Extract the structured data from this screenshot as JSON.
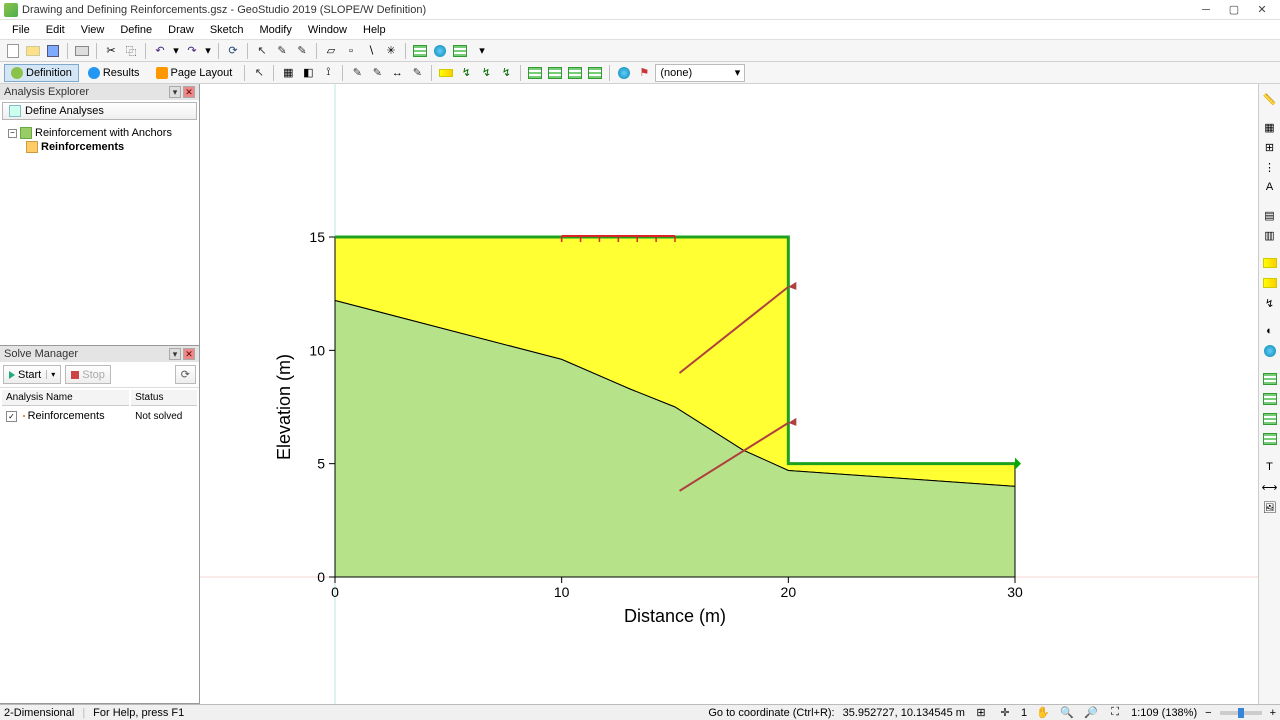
{
  "title_bar": {
    "text": "Drawing and Defining Reinforcements.gsz - GeoStudio 2019 (SLOPE/W Definition)"
  },
  "menus": [
    "File",
    "Edit",
    "View",
    "Define",
    "Draw",
    "Sketch",
    "Modify",
    "Window",
    "Help"
  ],
  "mode_tabs": {
    "definition": "Definition",
    "results": "Results",
    "page_layout": "Page Layout"
  },
  "dropdown_value": "(none)",
  "analysis_explorer": {
    "title": "Analysis Explorer",
    "define_button": "Define Analyses",
    "tree": {
      "root": "Reinforcement with Anchors",
      "child": "Reinforcements"
    }
  },
  "solve_manager": {
    "title": "Solve Manager",
    "start": "Start",
    "stop": "Stop",
    "cols": {
      "name": "Analysis Name",
      "status": "Status"
    },
    "row": {
      "name": "Reinforcements",
      "status": "Not solved"
    }
  },
  "status": {
    "left1": "2-Dimensional",
    "left2": "For Help, press F1",
    "coord_label": "Go to coordinate (Ctrl+R):",
    "coord_value": "35.952727, 10.134545 m",
    "page": "1",
    "zoom_text": "1:109 (138%)"
  },
  "chart_data": {
    "type": "area",
    "title": "",
    "xlabel": "Distance (m)",
    "ylabel": "Elevation (m)",
    "xlim": [
      0,
      30
    ],
    "ylim": [
      0,
      15
    ],
    "xticks": [
      0,
      10,
      20,
      30
    ],
    "yticks": [
      0,
      5,
      10,
      15
    ],
    "regions": [
      {
        "name": "upper-fill",
        "color": "#ffff33",
        "polygon": [
          [
            0,
            15
          ],
          [
            20,
            15
          ],
          [
            20,
            5
          ],
          [
            30,
            5
          ],
          [
            30,
            4
          ],
          [
            20,
            4.7
          ],
          [
            18,
            5.6
          ],
          [
            15,
            7.5
          ],
          [
            13,
            8.3
          ],
          [
            10,
            9.6
          ],
          [
            0,
            12.2
          ]
        ]
      },
      {
        "name": "foundation",
        "color": "#b6e38a",
        "polygon": [
          [
            0,
            12.2
          ],
          [
            10,
            9.6
          ],
          [
            13,
            8.3
          ],
          [
            15,
            7.5
          ],
          [
            18,
            5.6
          ],
          [
            20,
            4.7
          ],
          [
            30,
            4
          ],
          [
            30,
            0
          ],
          [
            0,
            0
          ]
        ]
      }
    ],
    "surface_load": {
      "x1": 10,
      "x2": 15,
      "y": 15
    },
    "anchors": [
      {
        "x1": 20,
        "y1": 12.8,
        "x2": 15.2,
        "y2": 9.0
      },
      {
        "x1": 20,
        "y1": 6.8,
        "x2": 15.2,
        "y2": 3.8
      }
    ],
    "slip_exit": {
      "x": 30,
      "y": 5
    }
  }
}
